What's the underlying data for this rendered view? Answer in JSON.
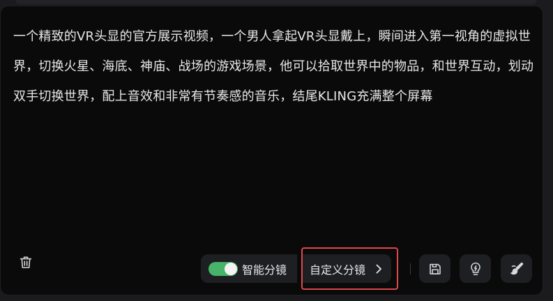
{
  "prompt": {
    "text": "一个精致的VR头显的官方展示视频，一个男人拿起VR头显戴上，瞬间进入第一视角的虚拟世界，切换火星、海底、神庙、战场的游戏场景，他可以拾取世界中的物品，和世界互动，划动双手切换世界，配上音效和非常有节奏感的音乐，结尾KLING充满整个屏幕"
  },
  "toolbar": {
    "delete_icon": "trash-icon",
    "smart_storyboard": {
      "label": "智能分镜",
      "enabled": true
    },
    "custom_storyboard": {
      "label": "自定义分镜",
      "chevron_icon": "chevron-right-icon"
    },
    "save_icon": "save-icon",
    "idea_icon": "lightbulb-icon",
    "brush_icon": "brush-icon"
  },
  "colors": {
    "toggle_on": "#47b46a",
    "highlight_border": "#e0474b",
    "panel_bg": "#0a0a0b",
    "button_bg": "#1e1f22",
    "text": "#e8e8ea"
  }
}
